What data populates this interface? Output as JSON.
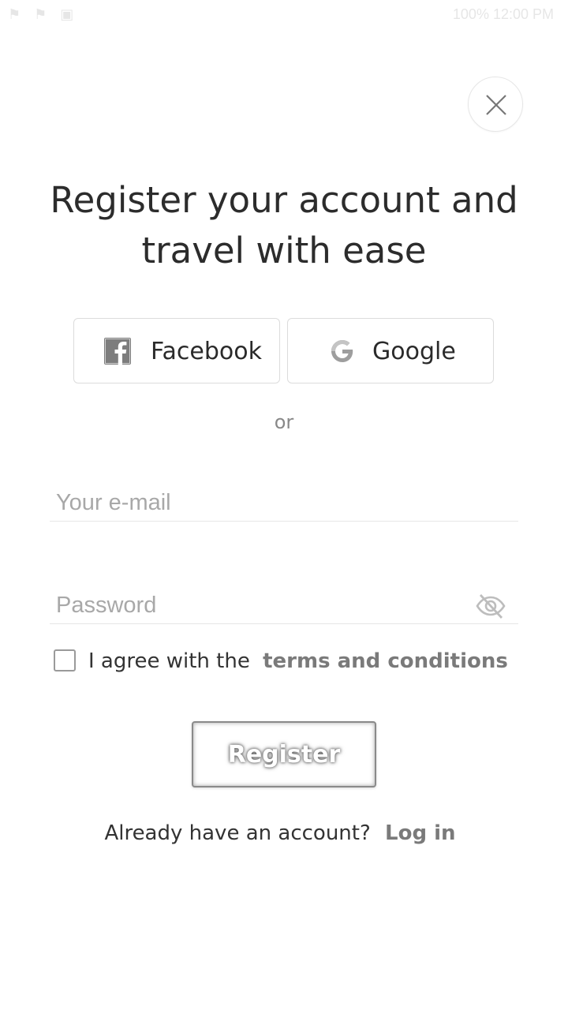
{
  "status_bar": {
    "left_icons": [
      "notification-icon",
      "notification-icon",
      "image-icon"
    ],
    "right_text": "100% 12:00 PM"
  },
  "close_button": {
    "icon": "close-icon"
  },
  "title_line1": "Register your account and",
  "title_line2": "travel with ease",
  "social": {
    "facebook": {
      "label": "Facebook",
      "icon": "facebook-icon"
    },
    "google": {
      "label": "Google",
      "icon": "google-icon"
    }
  },
  "or_text": "or",
  "email": {
    "placeholder": "Your e-mail",
    "value": ""
  },
  "password": {
    "placeholder": "Password",
    "value": "",
    "toggle_icon": "eye-off-icon"
  },
  "agree": {
    "text": "I agree with the",
    "link": "terms and conditions",
    "checked": false
  },
  "register_button": "Register",
  "login": {
    "text": "Already have an account?",
    "link": "Log in"
  },
  "colors": {
    "text": "#2c2c2c",
    "muted": "#a8a8a8",
    "link": "#7a7a7a",
    "border": "#dcdcdc"
  }
}
